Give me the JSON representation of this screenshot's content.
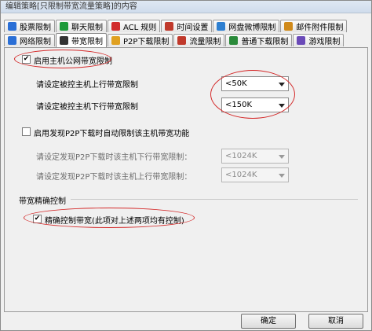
{
  "window": {
    "title": "编辑策略[只限制带宽流量策略]的内容"
  },
  "tabs_row1": [
    {
      "label": "股票限制",
      "icon": "stock-icon",
      "color": "#2a6fd6"
    },
    {
      "label": "聊天限制",
      "icon": "chat-icon",
      "color": "#1e9a3a"
    },
    {
      "label": "ACL 规则",
      "icon": "acl-icon",
      "color": "#d12a2a"
    },
    {
      "label": "时间设置",
      "icon": "clock-icon",
      "color": "#c0392b"
    },
    {
      "label": "网盘微博限制",
      "icon": "cloud-disk-icon",
      "color": "#2d7fd1"
    },
    {
      "label": "邮件附件限制",
      "icon": "mail-icon",
      "color": "#d08a1a"
    }
  ],
  "tabs_row2": [
    {
      "label": "网络限制",
      "icon": "network-icon",
      "color": "#2a6fd6"
    },
    {
      "label": "带宽限制",
      "icon": "bandwidth-icon",
      "color": "#333333"
    },
    {
      "label": "P2P下载限制",
      "icon": "p2p-icon",
      "color": "#e0a020"
    },
    {
      "label": "流量限制",
      "icon": "traffic-icon",
      "color": "#c0392b"
    },
    {
      "label": "普通下载限制",
      "icon": "download-icon",
      "color": "#2a8a3a"
    },
    {
      "label": "游戏限制",
      "icon": "game-icon",
      "color": "#6a4ab8"
    }
  ],
  "panel": {
    "enable_host_limit": {
      "label": "启用主机公网带宽限制",
      "checked": "✔"
    },
    "upload_label": "请设定被控主机上行带宽限制",
    "upload_value": "<50K",
    "download_label": "请设定被控主机下行带宽限制",
    "download_value": "<150K",
    "p2p_auto": {
      "label": "启用发现P2P下载时自动限制该主机带宽功能",
      "checked": ""
    },
    "p2p_down_label": "请设定发现P2P下载时该主机下行带宽限制：",
    "p2p_down_value": "<1024K",
    "p2p_up_label": "请设定发现P2P下载时该主机上行带宽限制：",
    "p2p_up_value": "<1024K",
    "group_title": "带宽精确控制",
    "precise": {
      "label": "精确控制带宽(此项对上述两项均有控制)",
      "checked": "✔"
    }
  },
  "buttons": {
    "ok": "确定",
    "cancel": "取消"
  }
}
